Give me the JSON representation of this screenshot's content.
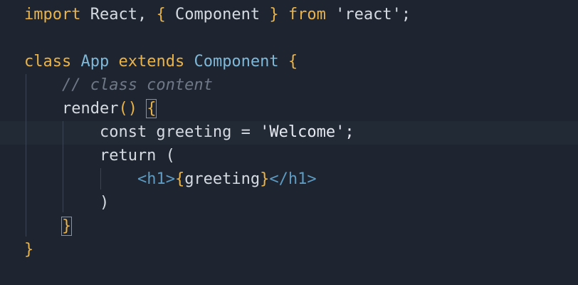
{
  "editor": {
    "language": "javascript",
    "lines": [
      {
        "tokens": [
          {
            "t": "import",
            "c": "kw"
          },
          {
            "t": " React, ",
            "c": "punc"
          },
          {
            "t": "{",
            "c": "kw"
          },
          {
            "t": " Component ",
            "c": "punc"
          },
          {
            "t": "}",
            "c": "kw"
          },
          {
            "t": " ",
            "c": "punc"
          },
          {
            "t": "from",
            "c": "kw"
          },
          {
            "t": " 'react';",
            "c": "punc"
          }
        ]
      },
      {
        "tokens": []
      },
      {
        "tokens": [
          {
            "t": "class",
            "c": "kw"
          },
          {
            "t": " ",
            "c": "punc"
          },
          {
            "t": "App",
            "c": "cls"
          },
          {
            "t": " ",
            "c": "punc"
          },
          {
            "t": "extends",
            "c": "kw"
          },
          {
            "t": " ",
            "c": "punc"
          },
          {
            "t": "Component",
            "c": "cls"
          },
          {
            "t": " ",
            "c": "punc"
          },
          {
            "t": "{",
            "c": "kw"
          }
        ]
      },
      {
        "tokens": [
          {
            "t": "    // class content",
            "c": "comment"
          }
        ]
      },
      {
        "tokens": [
          {
            "t": "    render",
            "c": "punc"
          },
          {
            "t": "()",
            "c": "kw"
          },
          {
            "t": " ",
            "c": "punc"
          },
          {
            "t": "{",
            "c": "kw",
            "hl": true
          }
        ]
      },
      {
        "tokens": [
          {
            "t": "        const",
            "c": "punc"
          },
          {
            "t": " greeting = ",
            "c": "punc"
          },
          {
            "t": "'Welcome';",
            "c": "str"
          }
        ]
      },
      {
        "tokens": [
          {
            "t": "        return",
            "c": "punc"
          },
          {
            "t": " (",
            "c": "punc"
          }
        ]
      },
      {
        "tokens": [
          {
            "t": "            ",
            "c": "punc"
          },
          {
            "t": "<h1>",
            "c": "tag"
          },
          {
            "t": "{",
            "c": "kw"
          },
          {
            "t": "greeting",
            "c": "punc"
          },
          {
            "t": "}",
            "c": "kw"
          },
          {
            "t": "</h1>",
            "c": "tag"
          }
        ]
      },
      {
        "tokens": [
          {
            "t": "        )",
            "c": "punc"
          }
        ]
      },
      {
        "tokens": [
          {
            "t": "    ",
            "c": "punc"
          },
          {
            "t": "}",
            "c": "kw",
            "hl": true
          }
        ]
      },
      {
        "tokens": [
          {
            "t": "}",
            "c": "kw"
          }
        ]
      }
    ]
  },
  "colors": {
    "background": "#1e2530",
    "keyword": "#e9b34a",
    "class_name": "#7fb8d8",
    "comment": "#6e7886",
    "tag": "#5d9bc2",
    "text": "#d6dbe2"
  }
}
